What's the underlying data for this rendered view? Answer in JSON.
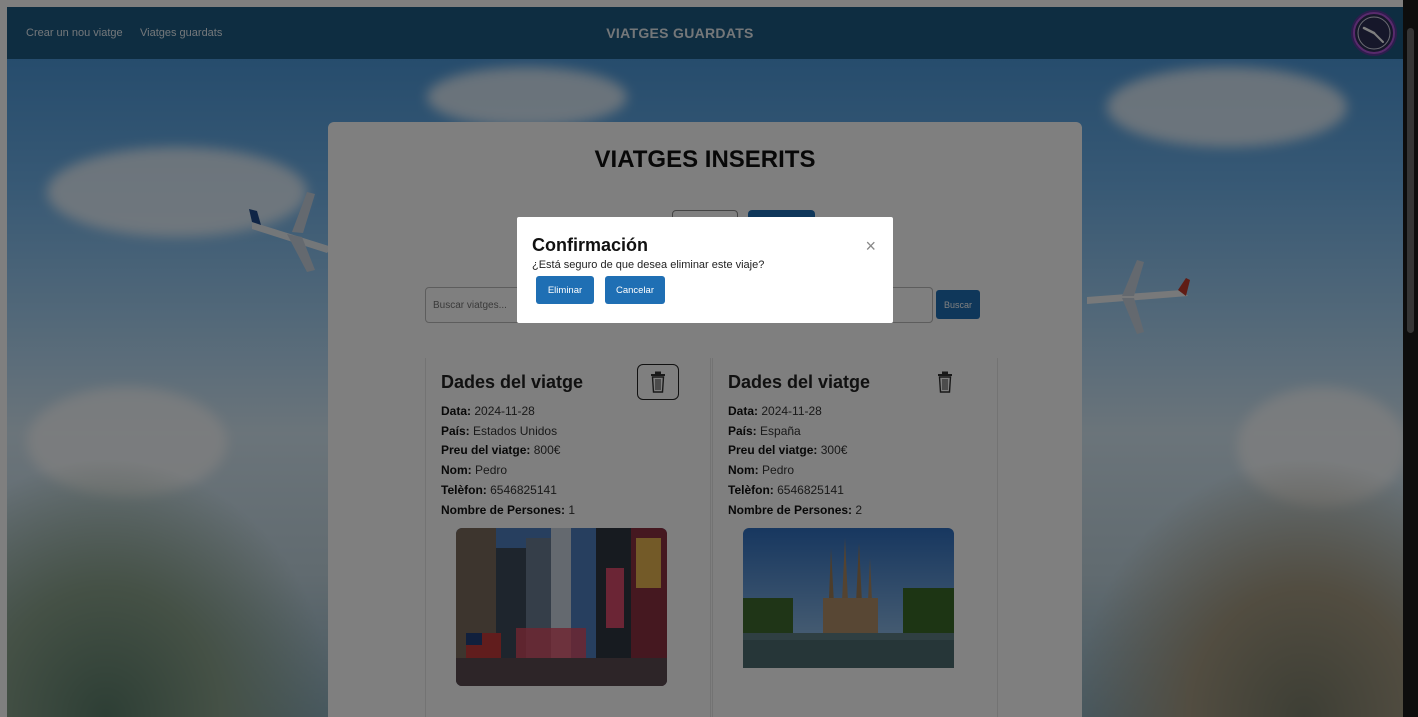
{
  "topbar": {
    "links": [
      "Crear un nou viatge",
      "Viatges guardats"
    ],
    "title": "VIATGES GUARDATS"
  },
  "card": {
    "title": "VIATGES INSERITS",
    "search": {
      "placeholder": "Buscar viatges...",
      "button_label": "Buscar"
    }
  },
  "trips": [
    {
      "heading": "Dades del viatge",
      "fields": [
        {
          "label": "Data:",
          "value": "2024-11-28"
        },
        {
          "label": "País:",
          "value": "Estados Unidos"
        },
        {
          "label": "Preu del viatge:",
          "value": "800€"
        },
        {
          "label": "Nom:",
          "value": "Pedro"
        },
        {
          "label": "Telèfon:",
          "value": "6546825141"
        },
        {
          "label": "Nombre de Persones:",
          "value": "1"
        }
      ]
    },
    {
      "heading": "Dades del viatge",
      "fields": [
        {
          "label": "Data:",
          "value": "2024-11-28"
        },
        {
          "label": "País:",
          "value": "España"
        },
        {
          "label": "Preu del viatge:",
          "value": "300€"
        },
        {
          "label": "Nom:",
          "value": "Pedro"
        },
        {
          "label": "Telèfon:",
          "value": "6546825141"
        },
        {
          "label": "Nombre de Persones:",
          "value": "2"
        }
      ]
    }
  ],
  "modal": {
    "title": "Confirmación",
    "close_glyph": "×",
    "message": "¿Está seguro de que desea eliminar este viaje?",
    "confirm_label": "Eliminar",
    "cancel_label": "Cancelar"
  },
  "colors": {
    "topbar": "#1c5a82",
    "primary_button": "#1f6fb4",
    "overlay": "rgba(0,0,0,0.5)"
  }
}
